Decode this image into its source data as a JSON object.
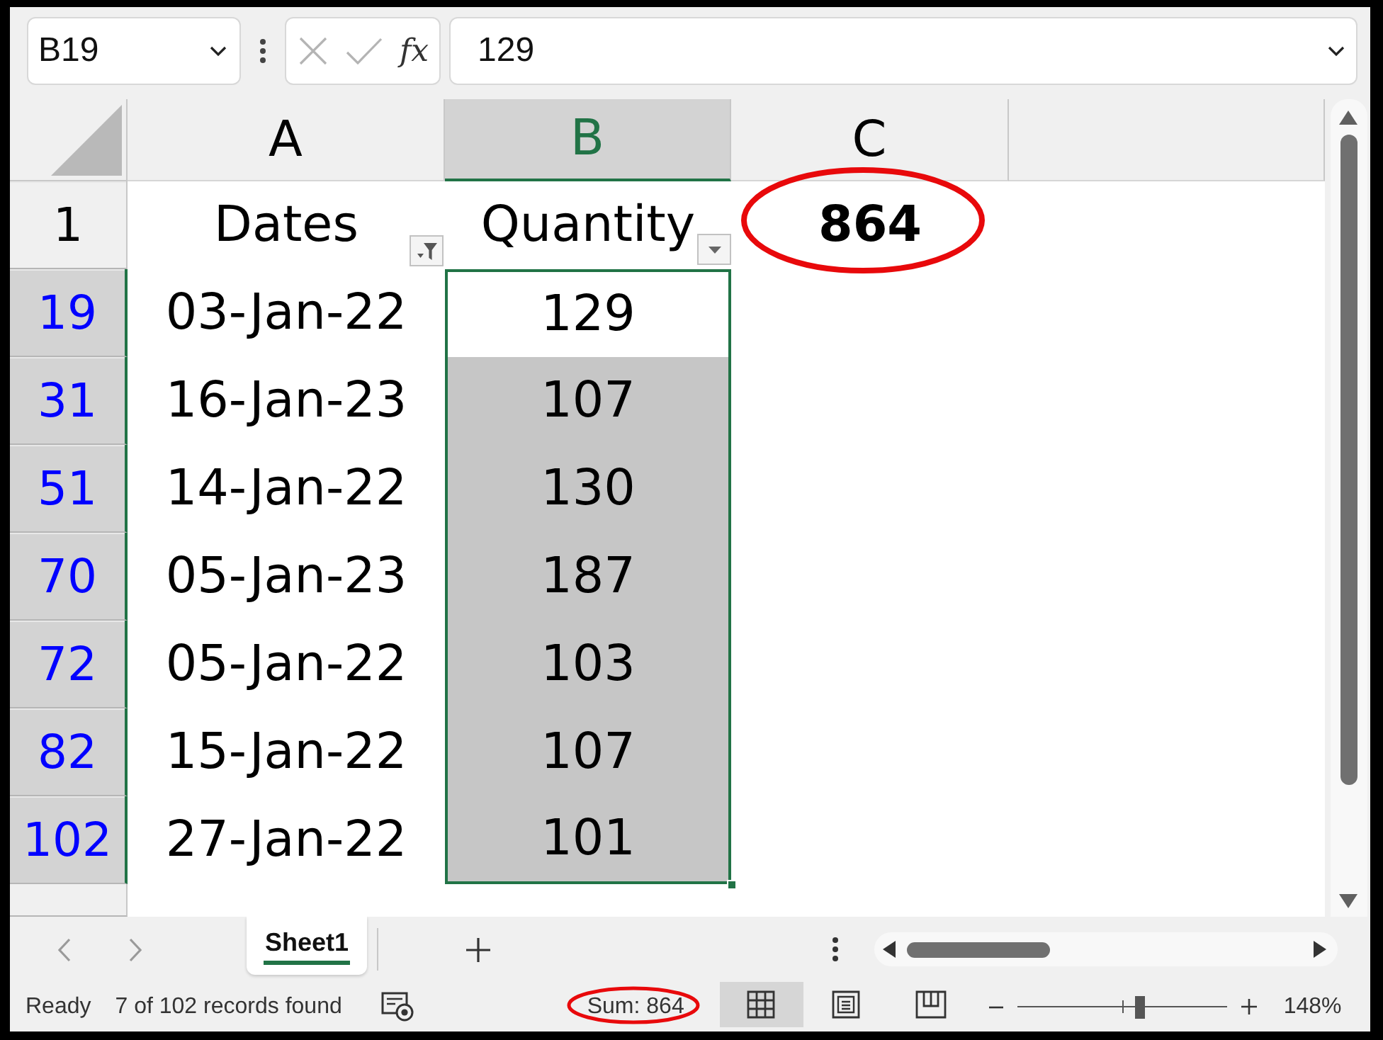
{
  "formula_bar": {
    "name_box": "B19",
    "function_label": "fx",
    "formula": "129"
  },
  "columns": [
    {
      "label": "A",
      "selected": false
    },
    {
      "label": "B",
      "selected": true
    },
    {
      "label": "C",
      "selected": false
    }
  ],
  "header_row": {
    "number": "1",
    "cells": [
      {
        "kind": "filtered_title",
        "text": "Dates",
        "circled": false
      },
      {
        "kind": "title",
        "text": "Quantity",
        "circled": false
      },
      {
        "kind": "total",
        "text": "864",
        "circled": true
      }
    ]
  },
  "rows": [
    {
      "number": "19",
      "date": "03-Jan-22",
      "quantity": "129",
      "filtered": true,
      "selected": true,
      "active": true
    },
    {
      "number": "31",
      "date": "16-Jan-23",
      "quantity": "107",
      "filtered": true,
      "selected": true,
      "active": false
    },
    {
      "number": "51",
      "date": "14-Jan-22",
      "quantity": "130",
      "filtered": true,
      "selected": true,
      "active": false
    },
    {
      "number": "70",
      "date": "05-Jan-23",
      "quantity": "187",
      "filtered": true,
      "selected": true,
      "active": false
    },
    {
      "number": "72",
      "date": "05-Jan-22",
      "quantity": "103",
      "filtered": true,
      "selected": true,
      "active": false
    },
    {
      "number": "82",
      "date": "15-Jan-22",
      "quantity": "107",
      "filtered": true,
      "selected": true,
      "active": false
    },
    {
      "number": "102",
      "date": "27-Jan-22",
      "quantity": "101",
      "filtered": true,
      "selected": true,
      "active": false
    }
  ],
  "sheet_tabs": [
    {
      "label": "Sheet1",
      "selected": true
    }
  ],
  "status_bar": {
    "mode": "Ready",
    "records": "7 of 102 records found",
    "sum": "Sum: 864",
    "sum_circled": true,
    "views": [
      {
        "kind": "normal",
        "selected": true
      },
      {
        "kind": "page_layout",
        "selected": false
      },
      {
        "kind": "page_break",
        "selected": false
      }
    ],
    "zoom": {
      "level": 0.58,
      "reading": "148%"
    }
  }
}
